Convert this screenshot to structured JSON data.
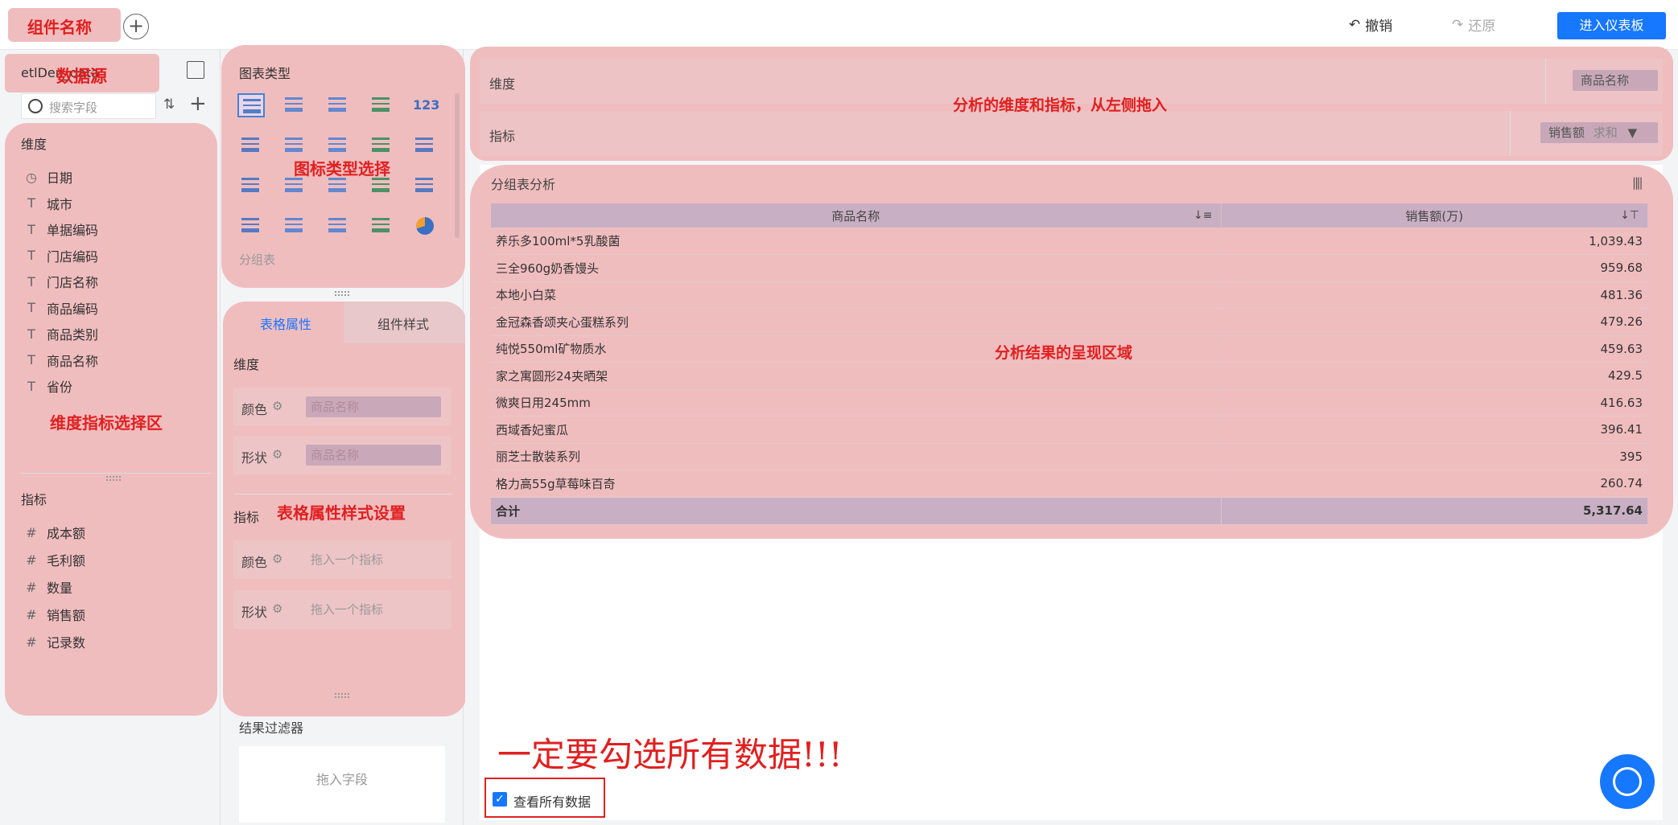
{
  "header": {
    "tab_name_annotation": "组件名称",
    "undo_label": "撤销",
    "redo_label": "还原",
    "dashboard_label": "进入仪表板"
  },
  "datasource": {
    "name": "etlDen_data",
    "annotation": "数据源"
  },
  "search": {
    "placeholder": "搜索字段"
  },
  "dimensions": {
    "label": "维度",
    "items": [
      {
        "icon": "clock-icon",
        "label": "日期"
      },
      {
        "icon": "text-icon",
        "label": "城市"
      },
      {
        "icon": "text-icon",
        "label": "单据编码"
      },
      {
        "icon": "text-icon",
        "label": "门店编码"
      },
      {
        "icon": "text-icon",
        "label": "门店名称"
      },
      {
        "icon": "text-icon",
        "label": "商品编码"
      },
      {
        "icon": "text-icon",
        "label": "商品类别"
      },
      {
        "icon": "text-icon",
        "label": "商品名称"
      },
      {
        "icon": "text-icon",
        "label": "省份"
      }
    ]
  },
  "metrics": {
    "label": "指标",
    "items": [
      {
        "icon": "hash-icon",
        "label": "成本额"
      },
      {
        "icon": "hash-icon",
        "label": "毛利额"
      },
      {
        "icon": "hash-icon",
        "label": "数量"
      },
      {
        "icon": "hash-icon",
        "label": "销售额"
      },
      {
        "icon": "hash-icon",
        "label": "记录数"
      }
    ]
  },
  "annotations": {
    "field_area": "维度指标选择区",
    "chart_type": "图标类型选择",
    "props": "表格属性样式设置",
    "shelf": "分析的维度和指标，从左侧拖入",
    "result": "分析结果的呈现区域",
    "big_note": "一定要勾选所有数据!!!"
  },
  "chart_types": {
    "label": "图表类型",
    "selected_name": "分组表"
  },
  "props_panel": {
    "tab_table": "表格属性",
    "tab_style": "组件样式",
    "dim_label": "维度",
    "metric_label": "指标",
    "color_label": "颜色",
    "shape_label": "形状",
    "dim_color_value": "商品名称",
    "dim_shape_value": "商品名称",
    "metric_placeholder": "拖入一个指标"
  },
  "result_filter": {
    "label": "结果过滤器",
    "placeholder": "拖入字段"
  },
  "shelf": {
    "dim_label": "维度",
    "dim_pill": "商品名称",
    "metric_label": "指标",
    "metric_pill_field": "销售额",
    "metric_pill_agg": "求和"
  },
  "chart": {
    "title": "分组表分析",
    "columns": [
      "商品名称",
      "销售额(万)"
    ],
    "rows": [
      [
        "养乐多100ml*5乳酸菌",
        "1,039.43"
      ],
      [
        "三全960g奶香馒头",
        "959.68"
      ],
      [
        "本地小白菜",
        "481.36"
      ],
      [
        "金冠森香颂夹心蛋糕系列",
        "479.26"
      ],
      [
        "纯悦550ml矿物质水",
        "459.63"
      ],
      [
        "家之寓圆形24夹晒架",
        "429.5"
      ],
      [
        "微爽日用245mm",
        "416.63"
      ],
      [
        "西域香妃蜜瓜",
        "396.41"
      ],
      [
        "丽芝士散装系列",
        "395"
      ],
      [
        "格力高55g草莓味百奇",
        "260.74"
      ]
    ],
    "total_label": "合计",
    "total_value": "5,317.64"
  },
  "view_all": {
    "label": "查看所有数据",
    "checked": true
  }
}
